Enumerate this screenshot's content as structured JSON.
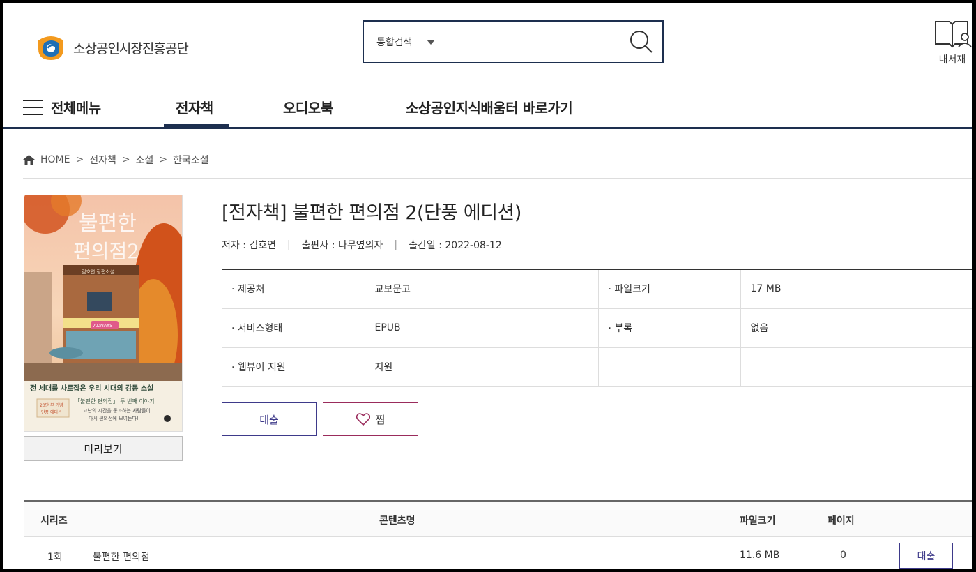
{
  "header": {
    "org_name": "소상공인시장진흥공단",
    "search_scope": "통합검색",
    "search_placeholder": "",
    "my_library_label": "내서재"
  },
  "nav": {
    "all_menu": "전체메뉴",
    "items": [
      "전자책",
      "오디오북",
      "소상공인지식배움터 바로가기"
    ],
    "active": "전자책"
  },
  "breadcrumb": {
    "home": "HOME",
    "items": [
      "전자책",
      "소설",
      "한국소설"
    ],
    "separator": ">"
  },
  "book": {
    "title": "[전자책] 불편한 편의점 2(단풍 에디션)",
    "author": "저자 : 김호연",
    "publisher": "출판사 : 나무옆의자",
    "pub_date": "출간일 : 2022-08-12",
    "cover": {
      "title_line1": "불편한",
      "title_line2": "편의점2",
      "author_line": "김호연 장편소설",
      "shop_sign": "ALWAYS",
      "tagline": "전 세대를 사로잡은 우리 시대의 감동 소설",
      "sub1": "「불편한 편의점」 두 번째 이야기",
      "sub2": "고난의 시간을 통과하는 사람들이",
      "sub3": "다시 편의점에 모여든다!",
      "edition_badge_1": "20만 부 기념",
      "edition_badge_2": "단풍 에디션"
    },
    "preview_label": "미리보기"
  },
  "info": {
    "rows": [
      {
        "k1": "· 제공처",
        "v1": "교보문고",
        "k2": "· 파일크기",
        "v2": "17 MB"
      },
      {
        "k1": "· 서비스형태",
        "v1": "EPUB",
        "k2": "· 부록",
        "v2": "없음"
      },
      {
        "k1": "· 웹뷰어 지원",
        "v1": "지원",
        "k2": "",
        "v2": ""
      }
    ]
  },
  "actions": {
    "loan": "대출",
    "wish": "찜"
  },
  "series": {
    "headers": {
      "series": "시리즈",
      "content": "콘텐츠명",
      "size": "파일크기",
      "pages": "페이지"
    },
    "rows": [
      {
        "no": "1회",
        "name": "불편한 편의점",
        "size": "11.6 MB",
        "pages": "0",
        "action": "대출"
      }
    ]
  },
  "colors": {
    "navy": "#1d2f4f",
    "loan_border": "#3e3a8a",
    "wish_border": "#9a2c5c",
    "logo_orange": "#f39a1e",
    "logo_blue": "#1f6fb5"
  }
}
